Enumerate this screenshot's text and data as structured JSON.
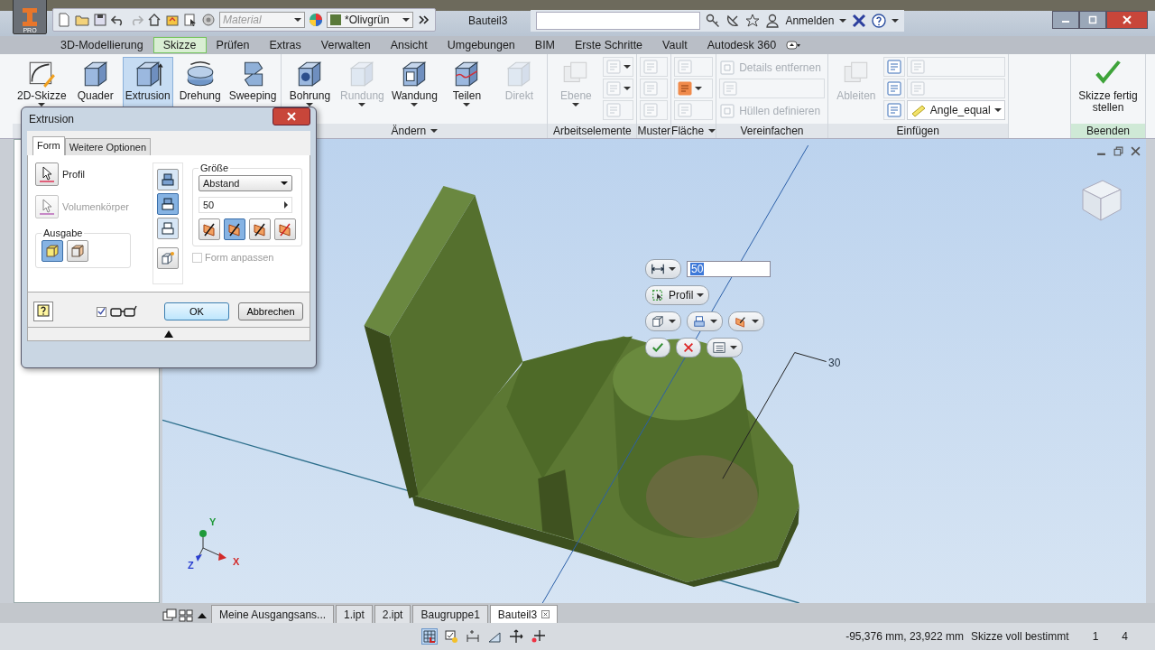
{
  "app_menu": {
    "badge": "PRO"
  },
  "quick_access": {
    "material": {
      "placeholder": "Material"
    },
    "appearance": {
      "value": "*Olivgrün"
    }
  },
  "window": {
    "title": "Bauteil3"
  },
  "infocenter": {
    "user": "Anmelden"
  },
  "ribbon_tabs": [
    {
      "label": "3D-Modellierung",
      "selected": false
    },
    {
      "label": "Skizze",
      "selected": true
    },
    {
      "label": "Prüfen",
      "selected": false
    },
    {
      "label": "Extras",
      "selected": false
    },
    {
      "label": "Verwalten",
      "selected": false
    },
    {
      "label": "Ansicht",
      "selected": false
    },
    {
      "label": "Umgebungen",
      "selected": false
    },
    {
      "label": "BIM",
      "selected": false
    },
    {
      "label": "Erste Schritte",
      "selected": false
    },
    {
      "label": "Vault",
      "selected": false
    },
    {
      "label": "Autodesk 360",
      "selected": false
    }
  ],
  "ribbon_groups": [
    {
      "items": [
        {
          "kind": "large",
          "label": "2D-Skizze",
          "disabled": false,
          "selected": false,
          "menu": true
        },
        {
          "kind": "large",
          "label": "Quader",
          "disabled": false,
          "selected": false,
          "menu": false
        },
        {
          "kind": "large",
          "label": "Extrusion",
          "disabled": false,
          "selected": true,
          "menu": false
        },
        {
          "kind": "large",
          "label": "Drehung",
          "disabled": false,
          "selected": false,
          "menu": false
        },
        {
          "kind": "large",
          "label": "Sweeping",
          "disabled": false,
          "selected": false,
          "menu": false
        }
      ]
    },
    {
      "label": "Ändern",
      "menu": true,
      "items": [
        {
          "kind": "large",
          "label": "Bohrung",
          "disabled": false,
          "selected": false,
          "menu": true
        },
        {
          "kind": "large",
          "label": "Rundung",
          "disabled": true,
          "selected": false,
          "menu": true
        },
        {
          "kind": "large",
          "label": "Wandung",
          "disabled": false,
          "selected": false,
          "menu": true
        },
        {
          "kind": "large",
          "label": "Teilen",
          "disabled": false,
          "selected": false,
          "menu": true
        },
        {
          "kind": "large",
          "label": "Direkt",
          "disabled": true,
          "selected": false,
          "menu": false
        }
      ]
    },
    {
      "label": "Arbeitselemente",
      "menu": false,
      "items": [
        {
          "kind": "large",
          "label": "Ebene",
          "disabled": true,
          "selected": false,
          "menu": true
        },
        {
          "kind": "small",
          "disabled": true,
          "menu": true
        },
        {
          "kind": "small",
          "disabled": true,
          "menu": true
        },
        {
          "kind": "small",
          "disabled": true,
          "menu": false
        }
      ]
    },
    {
      "label": "Muster",
      "menu": false,
      "items": [
        {
          "kind": "small",
          "disabled": true,
          "menu": false
        },
        {
          "kind": "small",
          "disabled": true,
          "menu": false
        },
        {
          "kind": "small",
          "disabled": true,
          "menu": false
        }
      ]
    },
    {
      "label": "Fläche",
      "menu": true,
      "items": [
        {
          "kind": "small",
          "disabled": true,
          "menu": false
        },
        {
          "kind": "small",
          "disabled": false,
          "menu": true
        },
        {
          "kind": "small",
          "disabled": true,
          "menu": false
        }
      ]
    },
    {
      "label": "Vereinfachen",
      "menu": false,
      "items": [
        {
          "kind": "text",
          "label": "Details entfernen",
          "disabled": true
        },
        {
          "kind": "small",
          "disabled": true,
          "menu": false
        },
        {
          "kind": "text",
          "label": "Hüllen definieren",
          "disabled": true
        }
      ]
    },
    {
      "label": "Einfügen",
      "menu": false,
      "items": [
        {
          "kind": "large",
          "label": "Ableiten",
          "disabled": true,
          "selected": false,
          "menu": false
        },
        {
          "kind": "small",
          "disabled": false,
          "menu": false
        },
        {
          "kind": "small",
          "disabled": false,
          "menu": false
        },
        {
          "kind": "small",
          "disabled": false,
          "menu": false
        },
        {
          "kind": "small",
          "disabled": true,
          "menu": false
        },
        {
          "kind": "small",
          "disabled": true,
          "menu": false
        },
        {
          "kind": "dropdown",
          "label": "Angle_equal",
          "menu": true
        }
      ]
    },
    {
      "label": "Beenden",
      "menu": false,
      "items": [
        {
          "kind": "large",
          "label": "Skizze fertig stellen",
          "disabled": false,
          "selected": false,
          "menu": false
        }
      ]
    }
  ],
  "dialog": {
    "title": "Extrusion",
    "tabs": [
      {
        "label": "Form",
        "selected": true
      },
      {
        "label": "Weitere Optionen",
        "selected": false
      }
    ],
    "selectors": [
      {
        "label": "Profil",
        "disabled": false
      },
      {
        "label": "Volumenkörper",
        "disabled": true
      }
    ],
    "output": {
      "label": "Ausgabe",
      "options": [
        {
          "selected": true
        },
        {
          "selected": false
        }
      ]
    },
    "operations": [
      {
        "selected": false
      },
      {
        "selected": true
      },
      {
        "selected": false
      }
    ],
    "extents": {
      "label": "Größe",
      "type": "Abstand",
      "distance": "50",
      "directions": [
        {
          "selected": false
        },
        {
          "selected": true
        },
        {
          "selected": false
        },
        {
          "selected": false
        }
      ]
    },
    "match_shape": {
      "label": "Form anpassen",
      "checked": false,
      "disabled": true
    },
    "preview": {
      "checked": true
    },
    "buttons": [
      {
        "label": "OK",
        "default": true
      },
      {
        "label": "Abbrechen",
        "default": false
      }
    ]
  },
  "mini_toolbar": {
    "distance": "50",
    "profile": "Profil"
  },
  "dimension": {
    "value": "30"
  },
  "triad": [
    {
      "label": "Y",
      "color": "#1f9a3a"
    },
    {
      "label": "X",
      "color": "#d22a2a"
    },
    {
      "label": "Z",
      "color": "#2a3fd0"
    }
  ],
  "document_tabs": [
    {
      "label": "Meine Ausgangsans...",
      "selected": false
    },
    {
      "label": "1.ipt",
      "selected": false
    },
    {
      "label": "2.ipt",
      "selected": false
    },
    {
      "label": "Baugruppe1",
      "selected": false
    },
    {
      "label": "Bauteil3",
      "selected": true
    }
  ],
  "status_bar": {
    "coordinates": "-95,376 mm, 23,922 mm",
    "message": "Skizze voll bestimmt",
    "count_1": "1",
    "count_2": "4"
  }
}
